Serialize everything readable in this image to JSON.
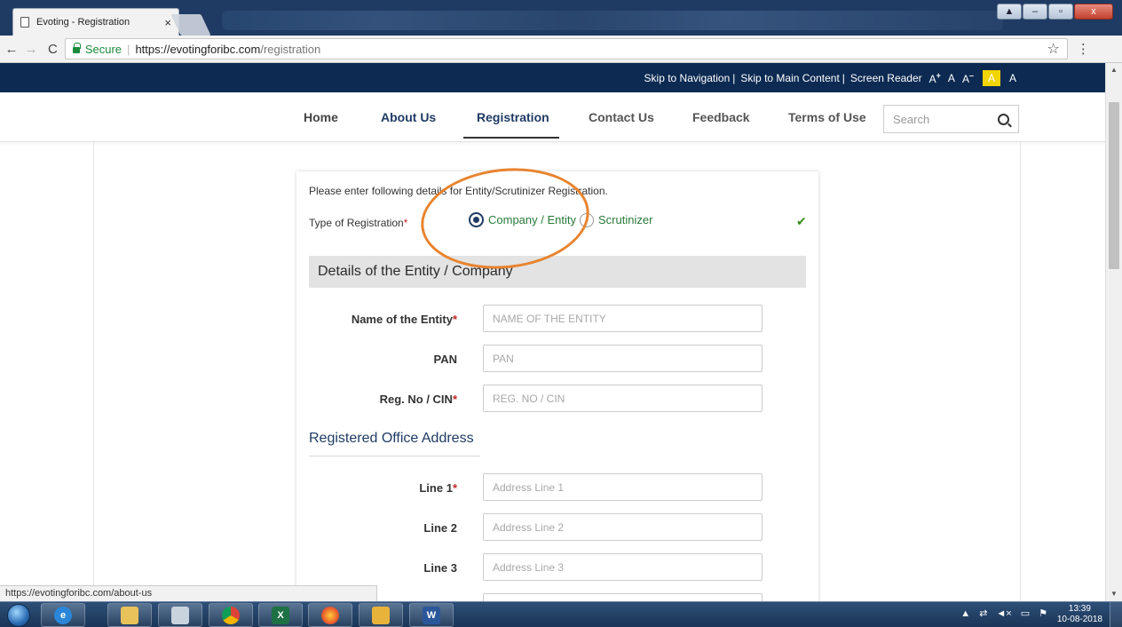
{
  "browser": {
    "tab_title": "Evoting - Registration",
    "tab_close": "×",
    "secure_label": "Secure",
    "url_host": "https://evotingforibc.com",
    "url_path": "/registration",
    "star": "☆",
    "menu": "⋮",
    "back": "←",
    "forward": "→",
    "reload": "C",
    "window_min": "–",
    "window_restore": "▫",
    "window_close": "x",
    "window_extra": "▲"
  },
  "skipbar": {
    "skip_nav": "Skip to Navigation",
    "skip_main": "Skip to Main Content",
    "screen_reader": "Screen Reader",
    "pipe": "|",
    "font_plus": "A",
    "font_plus_sign": "+",
    "font_normal": "A",
    "font_minus": "A",
    "font_minus_sign": "–",
    "contrast_high": "A",
    "contrast_normal": "A"
  },
  "nav": {
    "items": [
      {
        "label": "Home"
      },
      {
        "label": "About Us"
      },
      {
        "label": "Registration"
      },
      {
        "label": "Contact Us"
      },
      {
        "label": "Feedback"
      },
      {
        "label": "Terms of Use"
      }
    ],
    "search_placeholder": "Search"
  },
  "form": {
    "instruction": "Please enter following details for Entity/Scrutinizer Registration.",
    "type_label": "Type of Registration",
    "required_mark": "*",
    "radio_company": "Company / Entity",
    "radio_scrutinizer": "Scrutinizer",
    "check_mark": "✔",
    "section_title": "Details of the Entity / Company",
    "fields": [
      {
        "label": "Name of the Entity",
        "required": "*",
        "placeholder": "NAME OF THE ENTITY"
      },
      {
        "label": "PAN",
        "required": "",
        "placeholder": "PAN"
      },
      {
        "label": "Reg. No / CIN",
        "required": "*",
        "placeholder": "REG. NO / CIN"
      }
    ],
    "address_title": "Registered Office Address",
    "address_fields": [
      {
        "label": "Line 1",
        "required": "*",
        "placeholder": "Address Line 1"
      },
      {
        "label": "Line 2",
        "required": "",
        "placeholder": "Address Line 2"
      },
      {
        "label": "Line 3",
        "required": "",
        "placeholder": "Address Line 3"
      }
    ]
  },
  "status_url": "https://evotingforibc.com/about-us",
  "taskbar": {
    "clock_time": "13:39",
    "clock_date": "10-08-2018",
    "tray_arrow": "▲"
  },
  "colors": {
    "navy": "#0c2a52",
    "brand_blue": "#1f3b64",
    "accent_orange": "#e8842f",
    "success_green": "#3a8a1f",
    "required_red": "#c0262d"
  }
}
